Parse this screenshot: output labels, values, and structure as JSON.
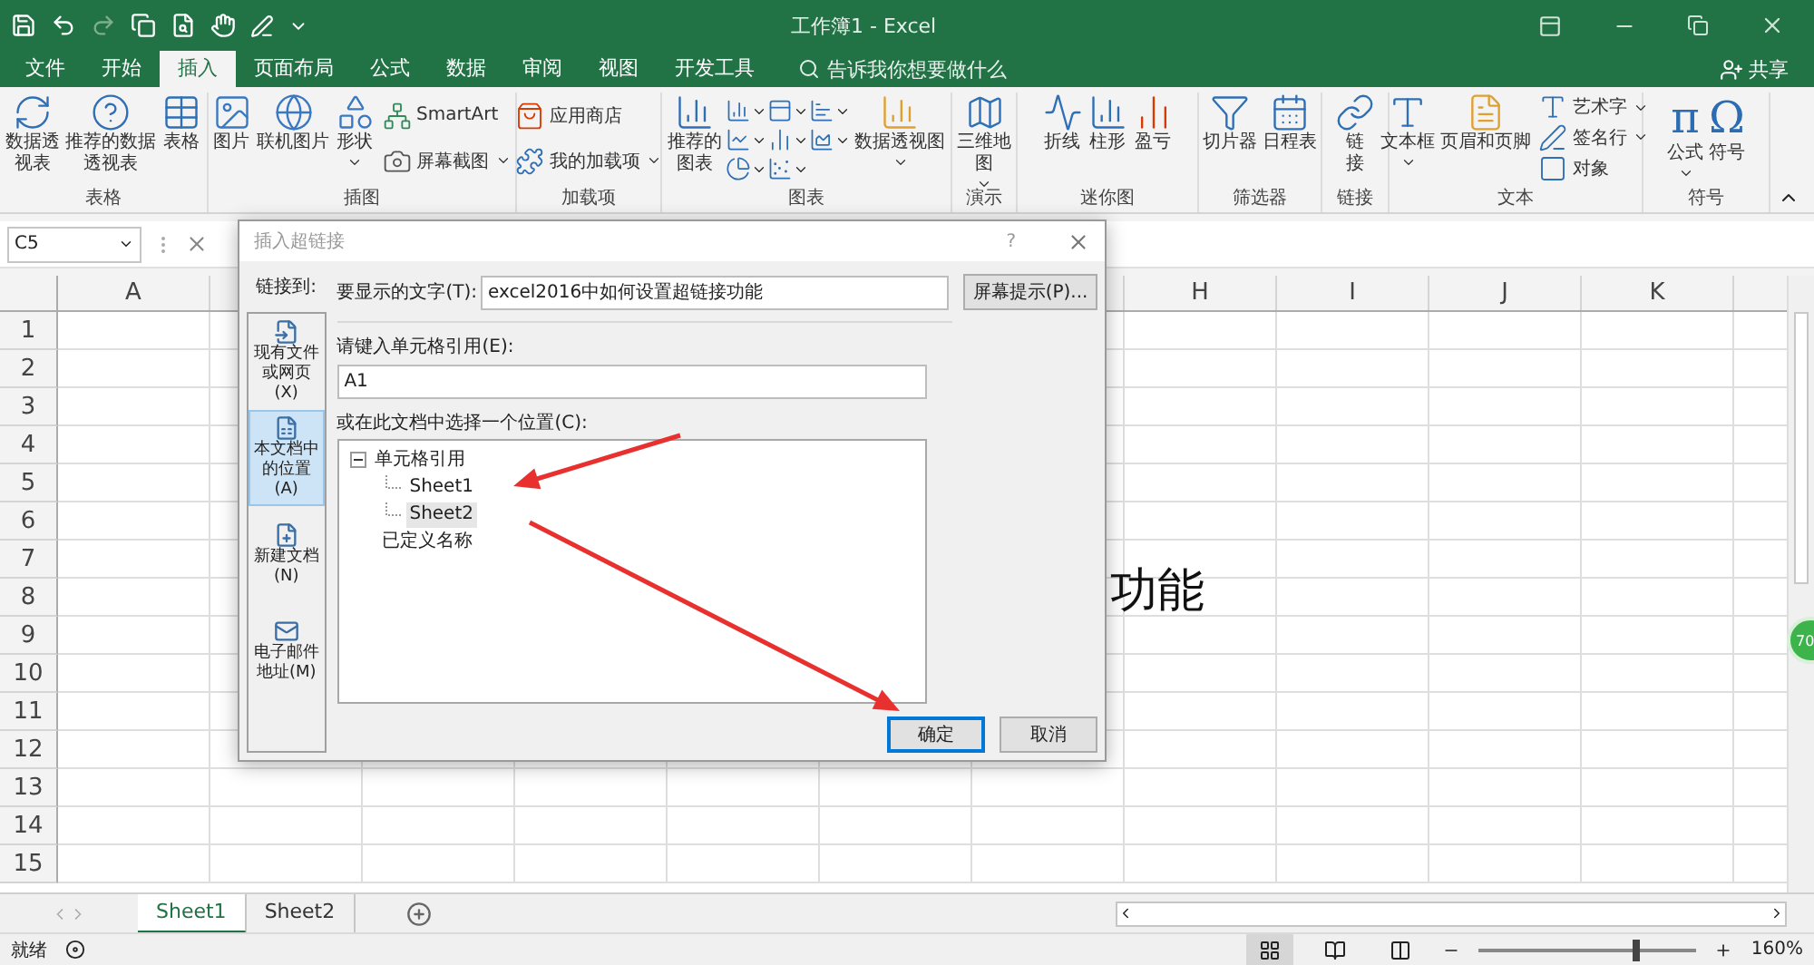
{
  "window": {
    "title": "工作簿1 - Excel"
  },
  "tabs": [
    {
      "label": "文件",
      "selected": false
    },
    {
      "label": "开始",
      "selected": false
    },
    {
      "label": "插入",
      "selected": true
    },
    {
      "label": "页面布局",
      "selected": false
    },
    {
      "label": "公式",
      "selected": false
    },
    {
      "label": "数据",
      "selected": false
    },
    {
      "label": "审阅",
      "selected": false
    },
    {
      "label": "视图",
      "selected": false
    },
    {
      "label": "开发工具",
      "selected": false
    }
  ],
  "tell_me": {
    "placeholder": "告诉我你想要做什么"
  },
  "share": "共享",
  "ribbon": {
    "groups": [
      {
        "label": "表格",
        "items": [
          {
            "kind": "large",
            "label": "数据透视表"
          },
          {
            "kind": "large",
            "label": "推荐的数据透视表"
          },
          {
            "kind": "large",
            "label": "表格"
          }
        ]
      },
      {
        "label": "插图",
        "items": [
          {
            "kind": "large",
            "label": "图片"
          },
          {
            "kind": "large",
            "label": "联机图片"
          },
          {
            "kind": "large",
            "label": "形状",
            "dropdown": true
          },
          {
            "kind": "stack",
            "items": [
              {
                "label": "SmartArt"
              },
              {
                "label": "屏幕截图",
                "dropdown": true
              }
            ]
          }
        ]
      },
      {
        "label": "加载项",
        "items": [
          {
            "kind": "stack",
            "items": [
              {
                "label": "应用商店"
              },
              {
                "label": "我的加载项",
                "dropdown": true
              }
            ]
          }
        ]
      },
      {
        "label": "图表",
        "items": [
          {
            "kind": "large",
            "label": "推荐的图表"
          },
          {
            "kind": "grid",
            "items": [
              {
                "dropdown": true
              },
              {
                "dropdown": true
              },
              {
                "dropdown": true
              },
              {
                "dropdown": true
              },
              {
                "dropdown": true
              },
              {
                "dropdown": true
              },
              {
                "dropdown": true
              },
              {
                "dropdown": true
              }
            ]
          },
          {
            "kind": "large",
            "label": "数据透视图",
            "dropdown": true
          }
        ]
      },
      {
        "label": "演示",
        "items": [
          {
            "kind": "large",
            "label": "三维地图",
            "dropdown": true
          }
        ]
      },
      {
        "label": "迷你图",
        "items": [
          {
            "kind": "large",
            "label": "折线"
          },
          {
            "kind": "large",
            "label": "柱形"
          },
          {
            "kind": "large",
            "label": "盈亏"
          }
        ]
      },
      {
        "label": "筛选器",
        "items": [
          {
            "kind": "large",
            "label": "切片器"
          },
          {
            "kind": "large",
            "label": "日程表"
          }
        ]
      },
      {
        "label": "链接",
        "items": [
          {
            "kind": "large",
            "label": "链接"
          }
        ]
      },
      {
        "label": "文本",
        "items": [
          {
            "kind": "large",
            "label": "文本框",
            "dropdown": true
          },
          {
            "kind": "large",
            "label": "页眉和页脚"
          },
          {
            "kind": "stack",
            "items": [
              {
                "label": "艺术字",
                "dropdown": true
              },
              {
                "label": "签名行",
                "dropdown": true
              },
              {
                "label": "对象"
              }
            ]
          }
        ]
      },
      {
        "label": "符号",
        "items": [
          {
            "kind": "glyph",
            "glyph": "π",
            "label": "公式",
            "dropdown": true
          },
          {
            "kind": "glyph",
            "glyph": "Ω",
            "label": "符号"
          }
        ]
      }
    ]
  },
  "formula_bar": {
    "name_box": "C5"
  },
  "sheet": {
    "columns": [
      "A",
      "H",
      "I",
      "J",
      "K"
    ],
    "rows": [
      "1",
      "2",
      "3",
      "4",
      "5",
      "6",
      "7",
      "8",
      "9",
      "10",
      "11",
      "12",
      "13",
      "14",
      "15"
    ],
    "cell_text": "功能"
  },
  "floating_badge": "70",
  "dialog": {
    "title": "插入超链接",
    "help": "?",
    "link_to": "链接到:",
    "places": [
      {
        "label": "现有文件或网页(X)",
        "selected": false
      },
      {
        "label": "本文档中的位置(A)",
        "selected": true
      },
      {
        "label": "新建文档(N)",
        "selected": false
      },
      {
        "label": "电子邮件地址(M)",
        "selected": false
      }
    ],
    "display_text": {
      "label": "要显示的文字(T):",
      "value": "excel2016中如何设置超链接功能"
    },
    "screen_tip": "屏幕提示(P)...",
    "cell_ref": {
      "label": "请键入单元格引用(E):",
      "value": "A1"
    },
    "location_label": "或在此文档中选择一个位置(C):",
    "tree": [
      {
        "label": "单元格引用",
        "selected": false,
        "expanded": true,
        "children": [
          {
            "label": "Sheet1",
            "selected": false
          },
          {
            "label": "Sheet2",
            "selected": true
          }
        ]
      },
      {
        "label": "已定义名称",
        "selected": false
      }
    ],
    "buttons": [
      {
        "label": "确定",
        "default": true
      },
      {
        "label": "取消",
        "default": false
      }
    ]
  },
  "sheet_tabs": [
    {
      "label": "Sheet1",
      "selected": true
    },
    {
      "label": "Sheet2",
      "selected": false
    }
  ],
  "status_bar": {
    "status": "就绪",
    "views": [
      {
        "selected": true
      },
      {
        "selected": false
      },
      {
        "selected": false
      }
    ],
    "zoom": {
      "level": 0.72,
      "reading": "160%"
    }
  }
}
